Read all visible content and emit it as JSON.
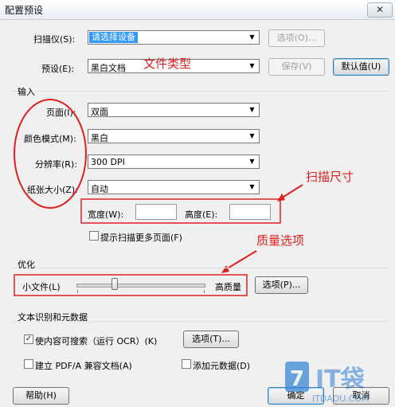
{
  "window": {
    "title": "配置预设",
    "close_glyph": "✕"
  },
  "scanner": {
    "label": "扫描仪(S):",
    "value": "请选择设备",
    "options_button": "选项(O)..."
  },
  "preset": {
    "label": "预设(E):",
    "value": "黑白文档",
    "save_button": "保存(V)",
    "default_button": "默认值(U)"
  },
  "input_group": {
    "title": "输入",
    "page": {
      "label": "页面(I):",
      "value": "双面"
    },
    "color_mode": {
      "label": "颜色模式(M):",
      "value": "黑白"
    },
    "resolution": {
      "label": "分辨率(R):",
      "value": "300 DPI"
    },
    "paper_size": {
      "label": "纸张大小(Z):",
      "value": "自动"
    },
    "width": {
      "label": "宽度(W):",
      "value": ""
    },
    "height": {
      "label": "高度(E):",
      "value": ""
    },
    "prompt_more_pages": {
      "label": "提示扫描更多页面(F)",
      "checked": false
    }
  },
  "optimize_group": {
    "title": "优化",
    "small_file_label": "小文件(L)",
    "high_quality_label": "高质量",
    "quality_level": 0.3,
    "options_button": "选项(P)..."
  },
  "ocr_group": {
    "title": "文本识别和元数据",
    "searchable": {
      "label": "使内容可搜索（运行 OCR）(K)",
      "checked": true
    },
    "options_button": "选项(T)...",
    "pdfa": {
      "label": "建立 PDF/A 兼容文档(A)",
      "checked": false
    },
    "metadata": {
      "label": "添加元数据(D)",
      "checked": false
    }
  },
  "footer": {
    "help_button": "帮助(H)",
    "ok_button": "确定",
    "cancel_button": "取消"
  },
  "annotations": {
    "file_type": "文件类型",
    "scan_size": "扫描尺寸",
    "quality": "质量选项",
    "color": "#e02020"
  },
  "watermark": {
    "brand": "IT袋",
    "url": "ITDAOU.COM"
  }
}
